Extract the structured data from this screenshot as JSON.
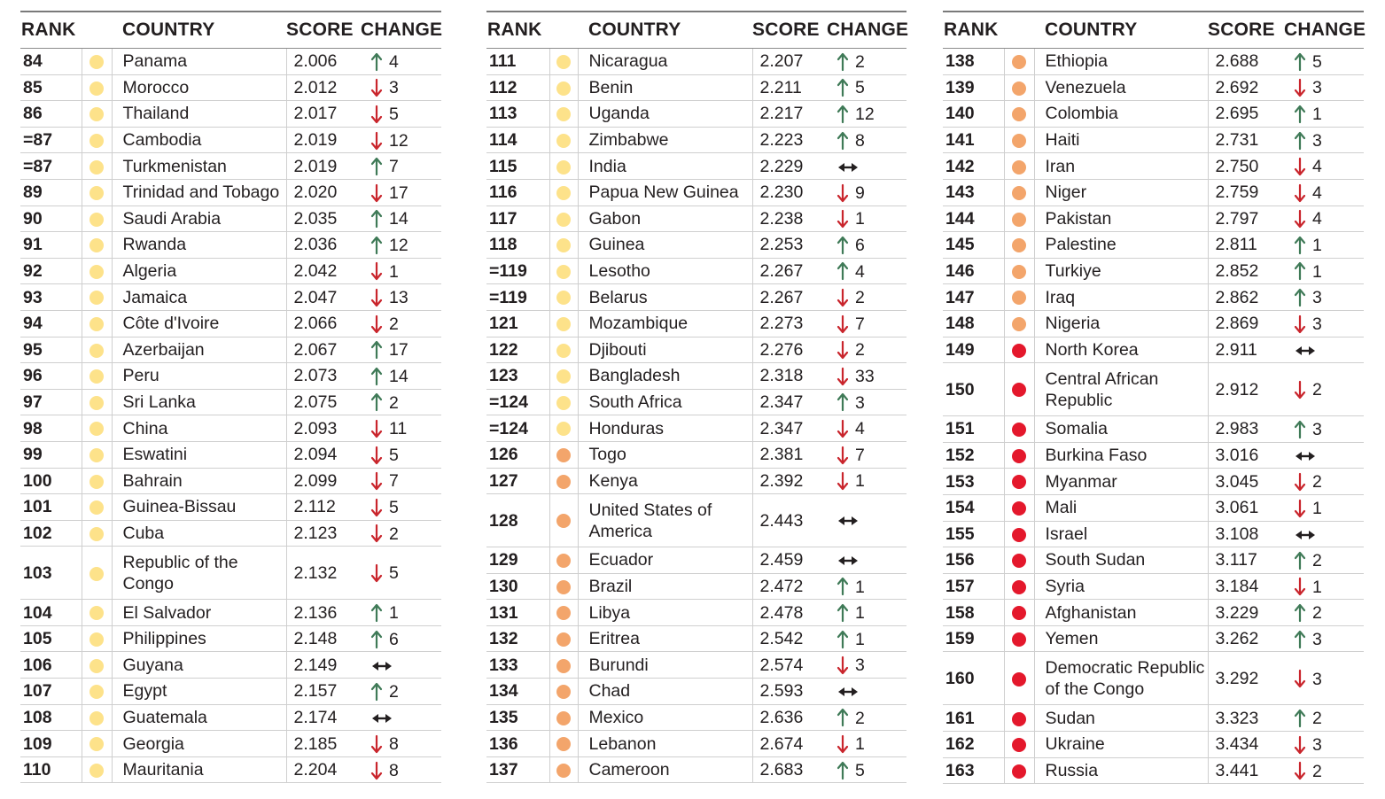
{
  "colors": {
    "yellow": "#fde28a",
    "orange": "#f3a56b",
    "red": "#e4182c",
    "up": "#3f7a57",
    "down": "#c9252c",
    "same": "#231f20"
  },
  "headers": {
    "rank": "RANK",
    "country": "COUNTRY",
    "score": "SCORE",
    "change": "CHANGE"
  },
  "columns": [
    {
      "rows": [
        {
          "rank": "84",
          "country": "Panama",
          "score": "2.006",
          "dir": "up",
          "change": "4",
          "tier": "yellow"
        },
        {
          "rank": "85",
          "country": "Morocco",
          "score": "2.012",
          "dir": "down",
          "change": "3",
          "tier": "yellow"
        },
        {
          "rank": "86",
          "country": "Thailand",
          "score": "2.017",
          "dir": "down",
          "change": "5",
          "tier": "yellow"
        },
        {
          "rank": "=87",
          "country": "Cambodia",
          "score": "2.019",
          "dir": "down",
          "change": "12",
          "tier": "yellow"
        },
        {
          "rank": "=87",
          "country": "Turkmenistan",
          "score": "2.019",
          "dir": "up",
          "change": "7",
          "tier": "yellow"
        },
        {
          "rank": "89",
          "country": "Trinidad and Tobago",
          "score": "2.020",
          "dir": "down",
          "change": "17",
          "tier": "yellow"
        },
        {
          "rank": "90",
          "country": "Saudi Arabia",
          "score": "2.035",
          "dir": "up",
          "change": "14",
          "tier": "yellow"
        },
        {
          "rank": "91",
          "country": "Rwanda",
          "score": "2.036",
          "dir": "up",
          "change": "12",
          "tier": "yellow"
        },
        {
          "rank": "92",
          "country": "Algeria",
          "score": "2.042",
          "dir": "down",
          "change": "1",
          "tier": "yellow"
        },
        {
          "rank": "93",
          "country": "Jamaica",
          "score": "2.047",
          "dir": "down",
          "change": "13",
          "tier": "yellow"
        },
        {
          "rank": "94",
          "country": "Côte d'Ivoire",
          "score": "2.066",
          "dir": "down",
          "change": "2",
          "tier": "yellow"
        },
        {
          "rank": "95",
          "country": "Azerbaijan",
          "score": "2.067",
          "dir": "up",
          "change": "17",
          "tier": "yellow"
        },
        {
          "rank": "96",
          "country": "Peru",
          "score": "2.073",
          "dir": "up",
          "change": "14",
          "tier": "yellow"
        },
        {
          "rank": "97",
          "country": "Sri Lanka",
          "score": "2.075",
          "dir": "up",
          "change": "2",
          "tier": "yellow"
        },
        {
          "rank": "98",
          "country": "China",
          "score": "2.093",
          "dir": "down",
          "change": "11",
          "tier": "yellow"
        },
        {
          "rank": "99",
          "country": "Eswatini",
          "score": "2.094",
          "dir": "down",
          "change": "5",
          "tier": "yellow"
        },
        {
          "rank": "100",
          "country": "Bahrain",
          "score": "2.099",
          "dir": "down",
          "change": "7",
          "tier": "yellow"
        },
        {
          "rank": "101",
          "country": "Guinea-Bissau",
          "score": "2.112",
          "dir": "down",
          "change": "5",
          "tier": "yellow"
        },
        {
          "rank": "102",
          "country": "Cuba",
          "score": "2.123",
          "dir": "down",
          "change": "2",
          "tier": "yellow"
        },
        {
          "rank": "103",
          "country": "Republic of the Congo",
          "score": "2.132",
          "dir": "down",
          "change": "5",
          "tier": "yellow",
          "tall": true
        },
        {
          "rank": "104",
          "country": "El Salvador",
          "score": "2.136",
          "dir": "up",
          "change": "1",
          "tier": "yellow"
        },
        {
          "rank": "105",
          "country": "Philippines",
          "score": "2.148",
          "dir": "up",
          "change": "6",
          "tier": "yellow"
        },
        {
          "rank": "106",
          "country": "Guyana",
          "score": "2.149",
          "dir": "same",
          "change": "",
          "tier": "yellow"
        },
        {
          "rank": "107",
          "country": "Egypt",
          "score": "2.157",
          "dir": "up",
          "change": "2",
          "tier": "yellow"
        },
        {
          "rank": "108",
          "country": "Guatemala",
          "score": "2.174",
          "dir": "same",
          "change": "",
          "tier": "yellow"
        },
        {
          "rank": "109",
          "country": "Georgia",
          "score": "2.185",
          "dir": "down",
          "change": "8",
          "tier": "yellow"
        },
        {
          "rank": "110",
          "country": "Mauritania",
          "score": "2.204",
          "dir": "down",
          "change": "8",
          "tier": "yellow"
        }
      ]
    },
    {
      "rows": [
        {
          "rank": "111",
          "country": "Nicaragua",
          "score": "2.207",
          "dir": "up",
          "change": "2",
          "tier": "yellow"
        },
        {
          "rank": "112",
          "country": "Benin",
          "score": "2.211",
          "dir": "up",
          "change": "5",
          "tier": "yellow"
        },
        {
          "rank": "113",
          "country": "Uganda",
          "score": "2.217",
          "dir": "up",
          "change": "12",
          "tier": "yellow"
        },
        {
          "rank": "114",
          "country": "Zimbabwe",
          "score": "2.223",
          "dir": "up",
          "change": "8",
          "tier": "yellow"
        },
        {
          "rank": "115",
          "country": "India",
          "score": "2.229",
          "dir": "same",
          "change": "",
          "tier": "yellow"
        },
        {
          "rank": "116",
          "country": "Papua New Guinea",
          "score": "2.230",
          "dir": "down",
          "change": "9",
          "tier": "yellow"
        },
        {
          "rank": "117",
          "country": "Gabon",
          "score": "2.238",
          "dir": "down",
          "change": "1",
          "tier": "yellow"
        },
        {
          "rank": "118",
          "country": "Guinea",
          "score": "2.253",
          "dir": "up",
          "change": "6",
          "tier": "yellow"
        },
        {
          "rank": "=119",
          "country": "Lesotho",
          "score": "2.267",
          "dir": "up",
          "change": "4",
          "tier": "yellow"
        },
        {
          "rank": "=119",
          "country": "Belarus",
          "score": "2.267",
          "dir": "down",
          "change": "2",
          "tier": "yellow"
        },
        {
          "rank": "121",
          "country": "Mozambique",
          "score": "2.273",
          "dir": "down",
          "change": "7",
          "tier": "yellow"
        },
        {
          "rank": "122",
          "country": "Djibouti",
          "score": "2.276",
          "dir": "down",
          "change": "2",
          "tier": "yellow"
        },
        {
          "rank": "123",
          "country": "Bangladesh",
          "score": "2.318",
          "dir": "down",
          "change": "33",
          "tier": "yellow"
        },
        {
          "rank": "=124",
          "country": "South Africa",
          "score": "2.347",
          "dir": "up",
          "change": "3",
          "tier": "yellow"
        },
        {
          "rank": "=124",
          "country": "Honduras",
          "score": "2.347",
          "dir": "down",
          "change": "4",
          "tier": "yellow"
        },
        {
          "rank": "126",
          "country": "Togo",
          "score": "2.381",
          "dir": "down",
          "change": "7",
          "tier": "orange"
        },
        {
          "rank": "127",
          "country": "Kenya",
          "score": "2.392",
          "dir": "down",
          "change": "1",
          "tier": "orange"
        },
        {
          "rank": "128",
          "country": "United States of America",
          "score": "2.443",
          "dir": "same",
          "change": "",
          "tier": "orange",
          "tall": true
        },
        {
          "rank": "129",
          "country": "Ecuador",
          "score": "2.459",
          "dir": "same",
          "change": "",
          "tier": "orange"
        },
        {
          "rank": "130",
          "country": "Brazil",
          "score": "2.472",
          "dir": "up",
          "change": "1",
          "tier": "orange"
        },
        {
          "rank": "131",
          "country": "Libya",
          "score": "2.478",
          "dir": "up",
          "change": "1",
          "tier": "orange"
        },
        {
          "rank": "132",
          "country": "Eritrea",
          "score": "2.542",
          "dir": "up",
          "change": "1",
          "tier": "orange"
        },
        {
          "rank": "133",
          "country": "Burundi",
          "score": "2.574",
          "dir": "down",
          "change": "3",
          "tier": "orange"
        },
        {
          "rank": "134",
          "country": "Chad",
          "score": "2.593",
          "dir": "same",
          "change": "",
          "tier": "orange"
        },
        {
          "rank": "135",
          "country": "Mexico",
          "score": "2.636",
          "dir": "up",
          "change": "2",
          "tier": "orange"
        },
        {
          "rank": "136",
          "country": "Lebanon",
          "score": "2.674",
          "dir": "down",
          "change": "1",
          "tier": "orange"
        },
        {
          "rank": "137",
          "country": "Cameroon",
          "score": "2.683",
          "dir": "up",
          "change": "5",
          "tier": "orange"
        }
      ]
    },
    {
      "rows": [
        {
          "rank": "138",
          "country": "Ethiopia",
          "score": "2.688",
          "dir": "up",
          "change": "5",
          "tier": "orange"
        },
        {
          "rank": "139",
          "country": "Venezuela",
          "score": "2.692",
          "dir": "down",
          "change": "3",
          "tier": "orange"
        },
        {
          "rank": "140",
          "country": "Colombia",
          "score": "2.695",
          "dir": "up",
          "change": "1",
          "tier": "orange"
        },
        {
          "rank": "141",
          "country": "Haiti",
          "score": "2.731",
          "dir": "up",
          "change": "3",
          "tier": "orange"
        },
        {
          "rank": "142",
          "country": "Iran",
          "score": "2.750",
          "dir": "down",
          "change": "4",
          "tier": "orange"
        },
        {
          "rank": "143",
          "country": "Niger",
          "score": "2.759",
          "dir": "down",
          "change": "4",
          "tier": "orange"
        },
        {
          "rank": "144",
          "country": "Pakistan",
          "score": "2.797",
          "dir": "down",
          "change": "4",
          "tier": "orange"
        },
        {
          "rank": "145",
          "country": "Palestine",
          "score": "2.811",
          "dir": "up",
          "change": "1",
          "tier": "orange"
        },
        {
          "rank": "146",
          "country": "Turkiye",
          "score": "2.852",
          "dir": "up",
          "change": "1",
          "tier": "orange"
        },
        {
          "rank": "147",
          "country": "Iraq",
          "score": "2.862",
          "dir": "up",
          "change": "3",
          "tier": "orange"
        },
        {
          "rank": "148",
          "country": "Nigeria",
          "score": "2.869",
          "dir": "down",
          "change": "3",
          "tier": "orange"
        },
        {
          "rank": "149",
          "country": "North Korea",
          "score": "2.911",
          "dir": "same",
          "change": "",
          "tier": "red"
        },
        {
          "rank": "150",
          "country": "Central African Republic",
          "score": "2.912",
          "dir": "down",
          "change": "2",
          "tier": "red",
          "tall": true
        },
        {
          "rank": "151",
          "country": "Somalia",
          "score": "2.983",
          "dir": "up",
          "change": "3",
          "tier": "red"
        },
        {
          "rank": "152",
          "country": "Burkina Faso",
          "score": "3.016",
          "dir": "same",
          "change": "",
          "tier": "red"
        },
        {
          "rank": "153",
          "country": "Myanmar",
          "score": "3.045",
          "dir": "down",
          "change": "2",
          "tier": "red"
        },
        {
          "rank": "154",
          "country": "Mali",
          "score": "3.061",
          "dir": "down",
          "change": "1",
          "tier": "red"
        },
        {
          "rank": "155",
          "country": "Israel",
          "score": "3.108",
          "dir": "same",
          "change": "",
          "tier": "red"
        },
        {
          "rank": "156",
          "country": "South Sudan",
          "score": "3.117",
          "dir": "up",
          "change": "2",
          "tier": "red"
        },
        {
          "rank": "157",
          "country": "Syria",
          "score": "3.184",
          "dir": "down",
          "change": "1",
          "tier": "red"
        },
        {
          "rank": "158",
          "country": "Afghanistan",
          "score": "3.229",
          "dir": "up",
          "change": "2",
          "tier": "red"
        },
        {
          "rank": "159",
          "country": "Yemen",
          "score": "3.262",
          "dir": "up",
          "change": "3",
          "tier": "red"
        },
        {
          "rank": "160",
          "country": "Democratic Republic of the Congo",
          "score": "3.292",
          "dir": "down",
          "change": "3",
          "tier": "red",
          "tall": true
        },
        {
          "rank": "161",
          "country": "Sudan",
          "score": "3.323",
          "dir": "up",
          "change": "2",
          "tier": "red"
        },
        {
          "rank": "162",
          "country": "Ukraine",
          "score": "3.434",
          "dir": "down",
          "change": "3",
          "tier": "red"
        },
        {
          "rank": "163",
          "country": "Russia",
          "score": "3.441",
          "dir": "down",
          "change": "2",
          "tier": "red"
        }
      ]
    }
  ]
}
